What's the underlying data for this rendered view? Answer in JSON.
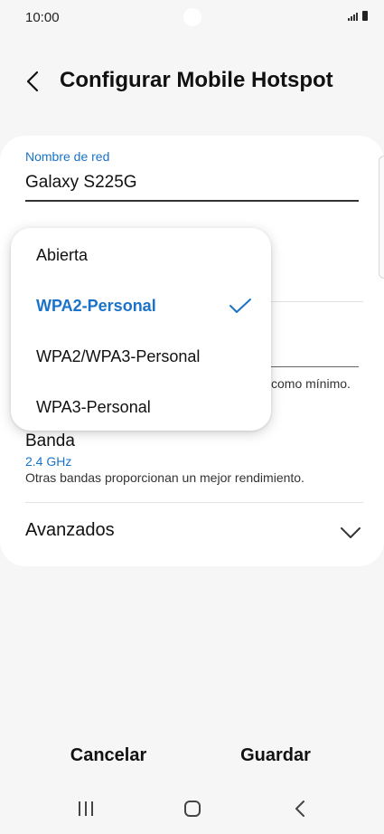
{
  "status_bar": {
    "time": "10:00"
  },
  "header": {
    "title": "Configurar Mobile Hotspot"
  },
  "network_name": {
    "label": "Nombre de red",
    "value": "Galaxy S225G"
  },
  "password": {
    "help_text": "como mínimo."
  },
  "security_dropdown": {
    "options": [
      {
        "label": "Abierta",
        "selected": false
      },
      {
        "label": "WPA2-Personal",
        "selected": true
      },
      {
        "label": "WPA2/WPA3-Personal",
        "selected": false
      },
      {
        "label": "WPA3-Personal",
        "selected": false
      }
    ]
  },
  "band": {
    "label": "Banda",
    "value": "2.4 GHz",
    "description": "Otras bandas proporcionan un mejor rendimiento."
  },
  "advanced": {
    "label": "Avanzados"
  },
  "actions": {
    "cancel": "Cancelar",
    "save": "Guardar"
  },
  "colors": {
    "accent": "#1a73c9",
    "background": "#f6f6f6",
    "card": "#ffffff"
  }
}
